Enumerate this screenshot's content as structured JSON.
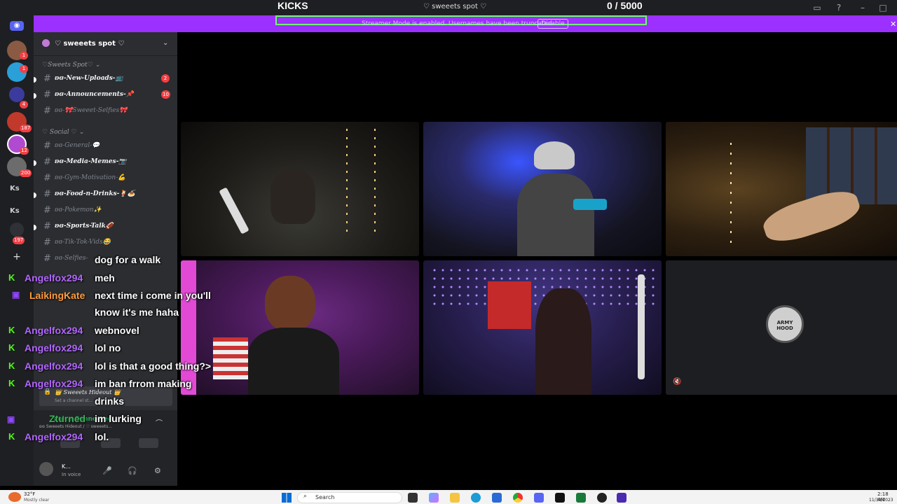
{
  "overlay": {
    "kicks_label": "KICKS",
    "kicks_count": "0 / 5000",
    "server_title": "♡ sweeets spot ♡"
  },
  "banner": {
    "text": "Streamer Mode is enabled. Usernames have been truncated.",
    "disable_label": "Disable",
    "close_glyph": "✕"
  },
  "rail": {
    "discord_glyph": "◉",
    "servers": [
      {
        "badge": "1"
      },
      {
        "badge": "1"
      },
      {
        "badge": "4"
      },
      {
        "badge": "187"
      },
      {
        "badge": "12"
      },
      {
        "badge": "200"
      }
    ],
    "text_servers": [
      "Ks",
      "Ks"
    ],
    "more_badge": "197",
    "add_glyph": "+"
  },
  "sidebar": {
    "server_name": "♡ sweeets spot ♡",
    "chevron": "⌄",
    "categories": {
      "sweets_spot": "♡Sweets Spot♡ ⌄",
      "social": "♡ Social ♡ ⌄"
    },
    "channels": [
      {
        "name": "ʚɞ-New-Uploads-📺",
        "unread": true,
        "badge": "2"
      },
      {
        "name": "ʚɞ-Announcements-📌",
        "unread": true,
        "badge": "10"
      },
      {
        "name": "ʚɞ-🎀Sweeet-Selfies🎀",
        "unread": false,
        "badge": ""
      },
      {
        "name": "ʚɞ-General-💬",
        "unread": false,
        "badge": ""
      },
      {
        "name": "ʚɞ-Media-Memes-📷",
        "unread": true,
        "badge": ""
      },
      {
        "name": "ʚɞ-Gym-Motivation-💪",
        "unread": false,
        "badge": ""
      },
      {
        "name": "ʚɞ-Food-n-Drinks-🍹🍝",
        "unread": true,
        "badge": ""
      },
      {
        "name": "ʚɞ-Pokemon✨",
        "unread": false,
        "badge": ""
      },
      {
        "name": "ʚɞ-Sports-Talk🏈",
        "unread": true,
        "badge": ""
      },
      {
        "name": "ʚɞ-Tik-Tok-Vids😂",
        "unread": false,
        "badge": ""
      },
      {
        "name": "ʚɞ-Selfies-",
        "unread": false,
        "badge": ""
      }
    ],
    "voice_channel": "👑 Sweeets Hideout 👑",
    "voice_status": "Set a channel st...",
    "voice_connected_label": "Voice Connected",
    "voice_path": "ʚɞ Sweeets Hideout / ♡ sweeets...",
    "user_name": "K...",
    "user_status": "In voice",
    "mic_glyph": "🎤",
    "headset_glyph": "🎧",
    "gear_glyph": "⚙"
  },
  "chat": [
    {
      "user": "",
      "platform": "",
      "text": "dog for a walk"
    },
    {
      "user": "Angelfox294",
      "platform": "kick",
      "text": "meh"
    },
    {
      "user": "LaikingKate",
      "platform": "twitch",
      "text": "next time i come in you'll"
    },
    {
      "user": "",
      "platform": "",
      "text": "know it's me haha"
    },
    {
      "user": "Angelfox294",
      "platform": "kick",
      "text": "webnovel"
    },
    {
      "user": "Angelfox294",
      "platform": "kick",
      "text": "lol no"
    },
    {
      "user": "Angelfox294",
      "platform": "kick",
      "text": "lol is that a good thing?>"
    },
    {
      "user": "Angelfox294",
      "platform": "kick",
      "text": "im ban frrom making"
    },
    {
      "user": "",
      "platform": "",
      "text": "drinks"
    },
    {
      "user": "Zturned",
      "platform": "twitch",
      "text": "im lurking"
    },
    {
      "user": "Angelfox294",
      "platform": "kick",
      "text": "lol."
    }
  ],
  "tiles": {
    "army_logo": "ARMY HOOD",
    "muted_glyph": "🔇"
  },
  "taskbar": {
    "weather_temp": "32°F",
    "weather_desc": "Mostly clear",
    "search_label": "Search",
    "time": "2:18 AM",
    "date": "11/30/2023"
  },
  "colors": {
    "banner": "#9b30ff",
    "kick_green": "#53fc18",
    "twitch_purple": "#9146ff",
    "chat_user_purple": "#b366ff",
    "chat_user_orange": "#ff9a3c"
  }
}
